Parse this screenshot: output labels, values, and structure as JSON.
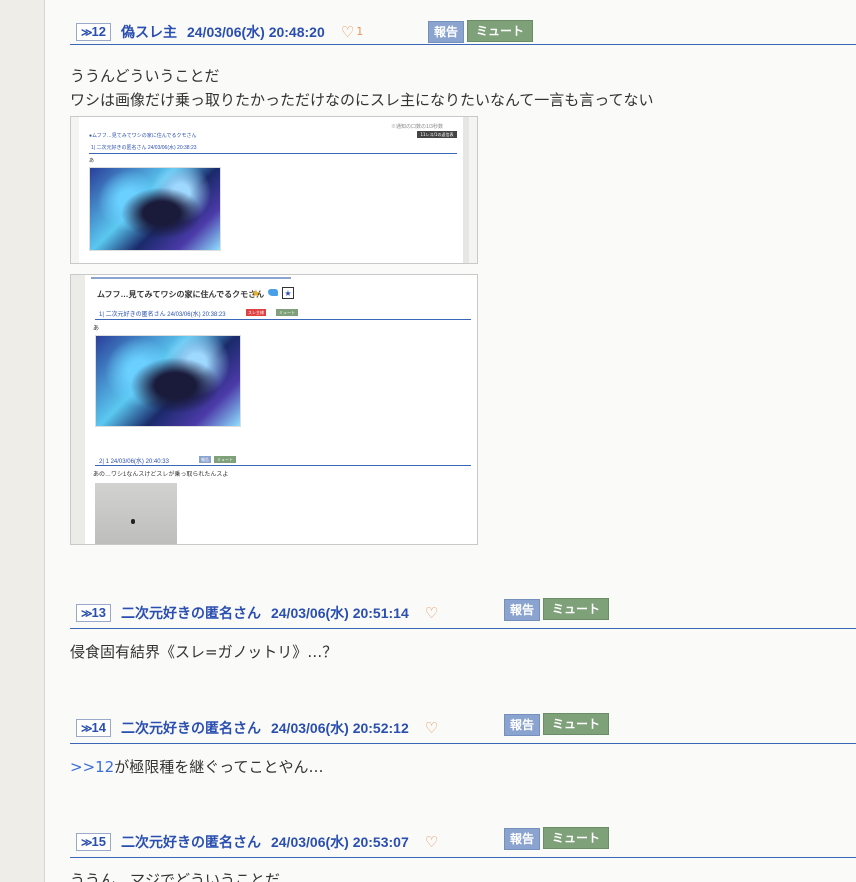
{
  "posts": [
    {
      "number_label": "12",
      "author": "偽スレ主",
      "datetime": "24/03/06(水) 20:48:20",
      "heart_count": "1",
      "report_label": "報告",
      "mute_label": "ミュート",
      "body_lines": [
        "ううんどういうことだ",
        "ワシは画像だけ乗っ取りたかっただけなのにスレ主になりたいなんて一言も言ってない"
      ],
      "attachments": [
        {
          "header_right": "※通知の口数の1/3秒数",
          "thread_title_small": "●ムフフ…見てみてワシの家に住んでるクモさん",
          "badge": "11レス/1の返信表",
          "res_line": "1| 二次元好きの匿名さん 24/03/06(水) 20:38:23",
          "body": "あ"
        },
        {
          "thread_title": "ムフフ…見てみてワシの家に住んでるクモさん",
          "res1_line": "1| 二次元好きの匿名さん 24/03/06(水) 20:38:23",
          "res1_tag_red": "スレ主様",
          "res1_tag_green": "ミュート",
          "res1_body": "あ",
          "res2_line": "2| 1 24/03/06(水) 20:40:33",
          "res2_tag_blue": "報告",
          "res2_tag_green": "ミュート",
          "res2_body": "あの…ワシ1なんスけどスレが乗っ取られたんスよ"
        }
      ]
    },
    {
      "number_label": "13",
      "author": "二次元好きの匿名さん",
      "datetime": "24/03/06(水) 20:51:14",
      "report_label": "報告",
      "mute_label": "ミュート",
      "body_lines": [
        "侵食固有結界《スレ=ガノットリ》…？"
      ]
    },
    {
      "number_label": "14",
      "author": "二次元好きの匿名さん",
      "datetime": "24/03/06(水) 20:52:12",
      "report_label": "報告",
      "mute_label": "ミュート",
      "anchor": ">>12",
      "body_rest": "が極限種を継ぐってことやん…"
    },
    {
      "number_label": "15",
      "author": "二次元好きの匿名さん",
      "datetime": "24/03/06(水) 20:53:07",
      "report_label": "報告",
      "mute_label": "ミュート",
      "body_lines": [
        "ううん…マジでどういうことだ"
      ]
    }
  ],
  "icons": {
    "resno_arrow": "≫",
    "heart": "♡",
    "star": "★"
  },
  "colors": {
    "link_blue": "#2a4fb0",
    "rule_blue": "#3a66b8",
    "heart_orange": "#e8935a",
    "report_bg": "#8aa3cf",
    "mute_bg": "#7fa17a"
  }
}
